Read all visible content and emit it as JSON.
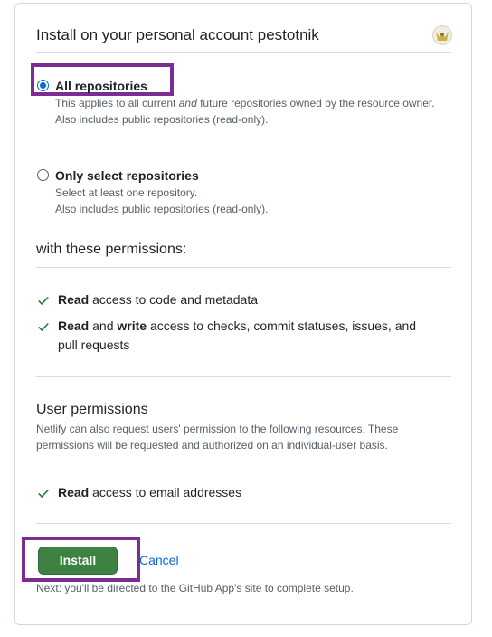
{
  "install": {
    "title": "Install on your personal account pestotnik",
    "avatar_icon": "account-avatar-icon",
    "repo_options": [
      {
        "label": "All repositories",
        "selected": true,
        "desc_pre": "This applies to all current ",
        "desc_em": "and",
        "desc_post": " future repositories owned by the resource owner.",
        "desc_line2": "Also includes public repositories (read-only)."
      },
      {
        "label": "Only select repositories",
        "selected": false,
        "desc_line1": "Select at least one repository.",
        "desc_line2": "Also includes public repositories (read-only)."
      }
    ],
    "permissions_heading": "with these permissions:",
    "permissions": [
      {
        "b1": "Read",
        "t1": " access to code and metadata"
      },
      {
        "b1": "Read",
        "t1": " and ",
        "b2": "write",
        "t2": " access to checks, commit statuses, issues, and pull requests"
      }
    ],
    "user_permissions_heading": "User permissions",
    "user_permissions_desc": "Netlify can also request users' permission to the following resources. These permissions will be requested and authorized on an individual-user basis.",
    "user_permissions": [
      {
        "b1": "Read",
        "t1": " access to email addresses"
      }
    ],
    "install_label": "Install",
    "cancel_label": "Cancel",
    "next_note": "Next: you'll be directed to the GitHub App's site to complete setup."
  },
  "colors": {
    "accent": "#0969da",
    "install_button": "#3d8143",
    "highlight": "#7b2d91",
    "check": "#1a7f37"
  }
}
